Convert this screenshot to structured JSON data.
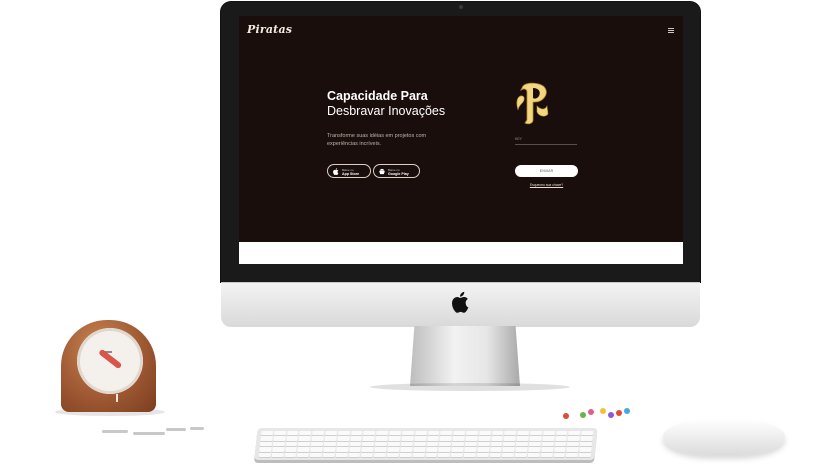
{
  "site": {
    "logo": "Piratas",
    "hero_title_bold": "Capacidade Para",
    "hero_title_light": "Desbravar Inovações",
    "hero_subtitle": "Transforme suas idéias em projetos com experiências incríveis.",
    "app_store_small": "Baixe no",
    "app_store_big": "App Store",
    "google_play_small": "Baixe no",
    "google_play_big": "Google Play",
    "input_label": "KEY",
    "cta_label": "ENVIAR",
    "help_link": "Esqueceu sua chave?"
  },
  "colors": {
    "screen_background": "#1a0e0c",
    "monogram_gold": "#f2d680",
    "clock_wood": "#9b5530",
    "clock_hand": "#d9544a"
  },
  "icons": [
    "menu-icon",
    "apple-icon",
    "android-icon",
    "apple-logo-icon",
    "p-monogram-icon"
  ]
}
